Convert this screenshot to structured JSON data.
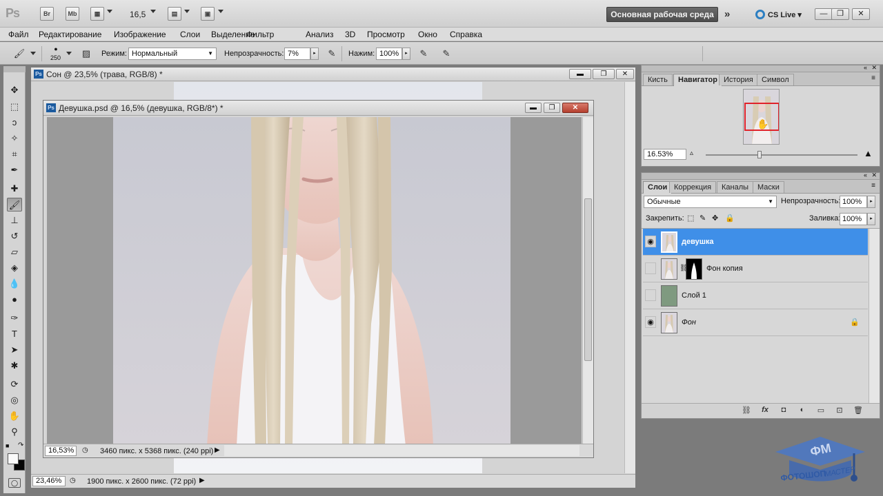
{
  "app": {
    "logo": "Ps",
    "bridge_btn": "Br",
    "minibridge_btn": "Mb",
    "zoom_value": "16,5",
    "workspace": "Основная рабочая среда",
    "cs_live": "CS Live"
  },
  "menu": [
    "Файл",
    "Редактирование",
    "Изображение",
    "Слои",
    "Выделение",
    "Фильтр",
    "Анализ",
    "3D",
    "Просмотр",
    "Окно",
    "Справка"
  ],
  "options": {
    "brush_size": "250",
    "mode_label": "Режим:",
    "mode_value": "Нормальный",
    "opacity_label": "Непрозрачность:",
    "opacity_value": "7%",
    "pressure_label": "Нажим:",
    "pressure_value": "100%"
  },
  "back_doc": {
    "title": "Сон @ 23,5% (трава, RGB/8) *",
    "zoom": "23,46%",
    "info": "1900 пикс. x 2600 пикс. (72 ppi)"
  },
  "front_doc": {
    "title": "Девушка.psd @ 16,5% (девушка, RGB/8*) *",
    "zoom": "16,53%",
    "info": "3460 пикс. x 5368 пикс. (240 ppi)"
  },
  "navigator": {
    "tabs": [
      "Кисть",
      "Навигатор",
      "История",
      "Символ"
    ],
    "active_tab": "Навигатор",
    "zoom": "16.53%"
  },
  "layers_panel": {
    "tabs": [
      "Слои",
      "Коррекция",
      "Каналы",
      "Маски"
    ],
    "active_tab": "Слои",
    "blend_mode": "Обычные",
    "opacity_label": "Непрозрачность:",
    "opacity_value": "100%",
    "lock_label": "Закрепить:",
    "fill_label": "Заливка:",
    "fill_value": "100%",
    "layers": [
      {
        "name": "девушка",
        "visible": true,
        "selected": true
      },
      {
        "name": "Фон копия",
        "visible": false,
        "selected": false,
        "has_mask": true
      },
      {
        "name": "Слой 1",
        "visible": false,
        "selected": false,
        "color": "#7f9a80"
      },
      {
        "name": "Фон",
        "visible": true,
        "selected": false,
        "locked": true
      }
    ]
  },
  "watermark": {
    "top": "ФМ",
    "left": "ФОТОШОП",
    "right": "МАСТЕР"
  },
  "colors": {
    "selected_layer": "#3f8fe8",
    "navigator_frame": "#e0222a",
    "watermark_blue": "#4a78c8"
  }
}
